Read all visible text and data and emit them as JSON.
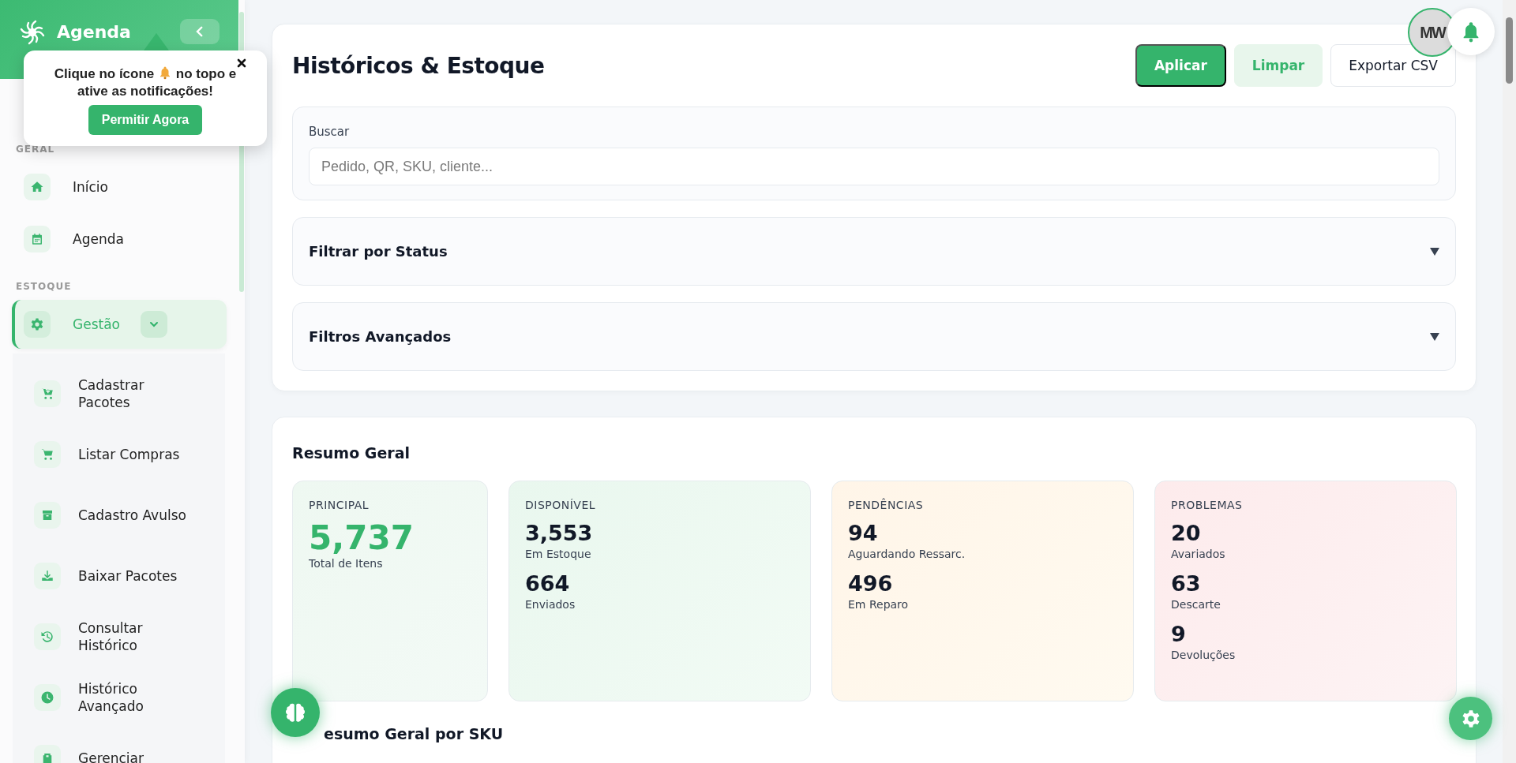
{
  "sidebar": {
    "brand": "Agenda",
    "sections": [
      {
        "label": "GERAL",
        "items": [
          {
            "label": "Início",
            "selected": false
          },
          {
            "label": "Agenda",
            "selected": false
          }
        ]
      },
      {
        "label": "ESTOQUE",
        "items": [
          {
            "label": "Gestão",
            "selected": true,
            "expanded": true,
            "children": [
              {
                "label": "Cadastrar Pacotes"
              },
              {
                "label": "Listar Compras"
              },
              {
                "label": "Cadastro Avulso"
              },
              {
                "label": "Baixar Pacotes"
              },
              {
                "label": "Consultar Histórico"
              },
              {
                "label": "Histórico Avançado"
              },
              {
                "label": "Gerenciar"
              }
            ]
          }
        ]
      }
    ]
  },
  "notification_popup": {
    "message": [
      "Clique no ícone",
      "no topo e",
      "ative as notificações!"
    ],
    "button": "Permitir Agora"
  },
  "user": {
    "initials": "MW"
  },
  "filters_card": {
    "title": "Históricos & Estoque",
    "buttons": [
      {
        "label": "Aplicar",
        "kind": "primary"
      },
      {
        "label": "Limpar",
        "kind": "soft"
      },
      {
        "label": "Exportar CSV",
        "kind": "outline"
      }
    ],
    "search": {
      "label": "Buscar",
      "placeholder": "Pedido, QR, SKU, cliente..."
    },
    "panels": [
      {
        "title": "Filtrar por Status",
        "expanded": false
      },
      {
        "title": "Filtros Avançados",
        "expanded": false
      }
    ]
  },
  "summary": {
    "title": "Resumo Geral",
    "cards": [
      {
        "label": "PRINCIPAL",
        "kind": "principal",
        "stats": [
          {
            "value": "5,737",
            "caption": "Total de Itens"
          }
        ]
      },
      {
        "label": "DISPONÍVEL",
        "kind": "available",
        "stats": [
          {
            "value": "3,553",
            "caption": "Em Estoque"
          },
          {
            "value": "664",
            "caption": "Enviados"
          }
        ]
      },
      {
        "label": "PENDÊNCIAS",
        "kind": "pending",
        "stats": [
          {
            "value": "94",
            "caption": "Aguardando Ressarc."
          },
          {
            "value": "496",
            "caption": "Em Reparo"
          }
        ]
      },
      {
        "label": "PROBLEMAS",
        "kind": "problem",
        "stats": [
          {
            "value": "20",
            "caption": "Avariados"
          },
          {
            "value": "63",
            "caption": "Descarte"
          },
          {
            "value": "9",
            "caption": "Devoluções"
          }
        ]
      }
    ],
    "sku_title": "esumo Geral por SKU"
  }
}
